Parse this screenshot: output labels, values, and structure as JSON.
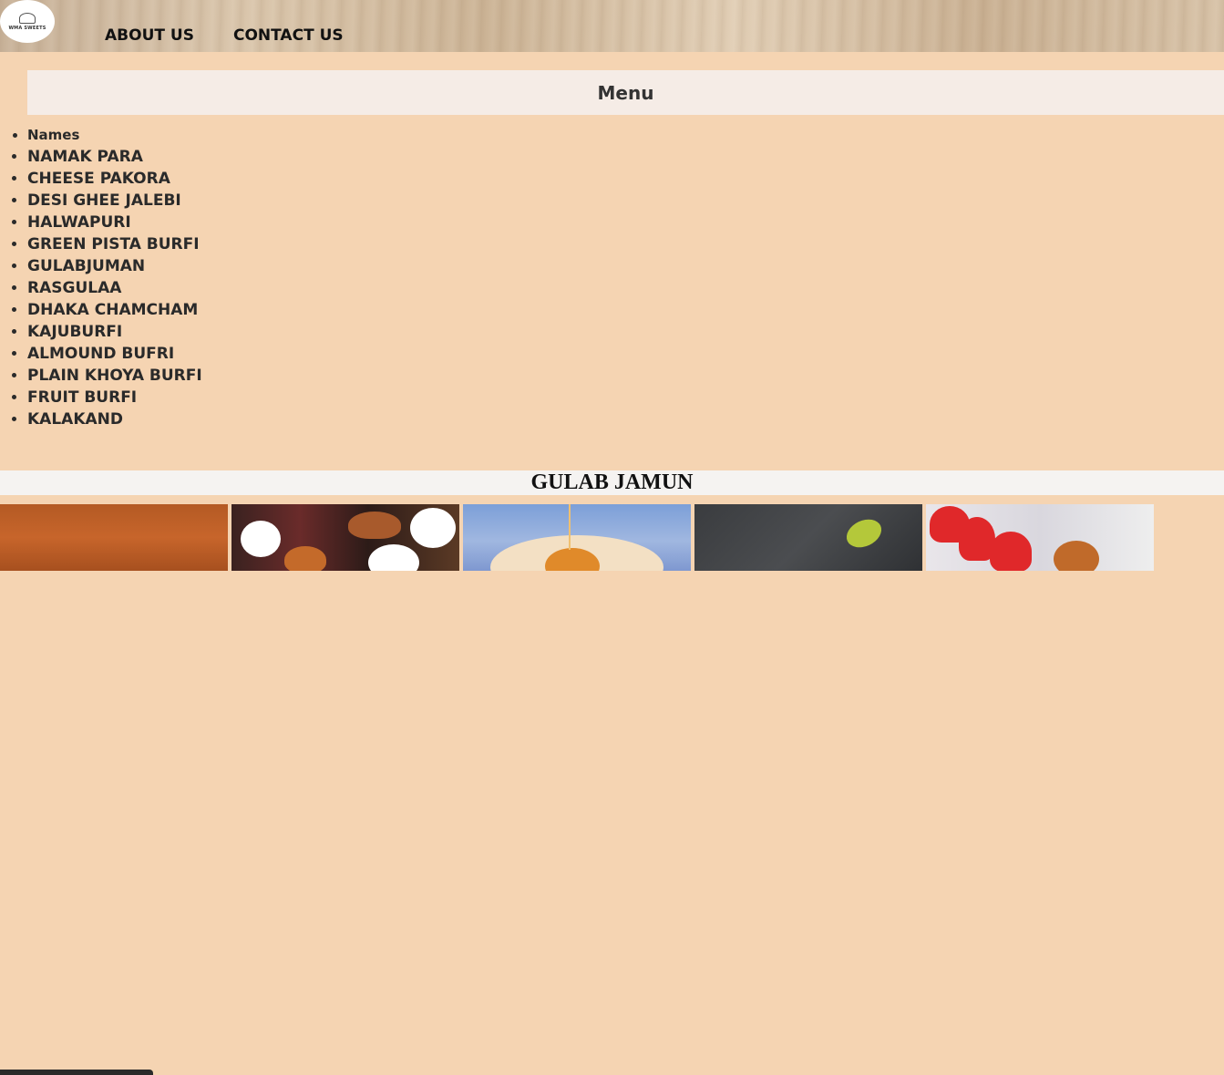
{
  "header": {
    "logo_text": "WMA SWEETS",
    "nav": [
      {
        "label": "ABOUT US"
      },
      {
        "label": "CONTACT US"
      }
    ]
  },
  "menu": {
    "title": "Menu",
    "items": [
      "Names",
      "NAMAK PARA",
      "CHEESE PAKORA",
      "DESI GHEE JALEBI",
      "HALWAPURI",
      "GREEN PISTA BURFI",
      "GULABJUMAN",
      "RASGULAA",
      "DHAKA CHAMCHAM",
      "KAJUBURFI",
      "ALMOUND BUFRI",
      "PLAIN KHOYA BURFI",
      "FRUIT BURFI",
      "KALAKAND"
    ]
  },
  "section": {
    "title": "GULAB JAMUN"
  }
}
